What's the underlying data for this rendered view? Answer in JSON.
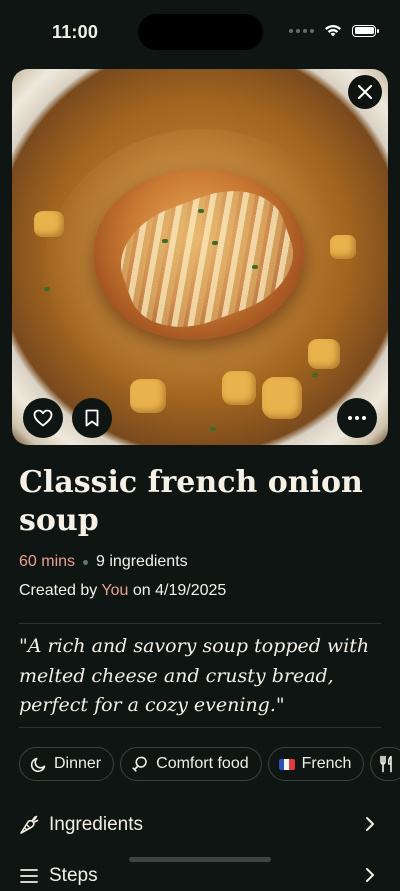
{
  "status_bar": {
    "time": "11:00"
  },
  "hero": {
    "image_alt": "Bowl of french onion soup topped with cheesy toast",
    "close_icon": "close-icon",
    "favorite_icon": "heart-icon",
    "bookmark_icon": "bookmark-icon",
    "more_icon": "more-horizontal-icon"
  },
  "recipe": {
    "title": "Classic french onion soup",
    "duration": "60 mins",
    "ingredient_count": "9 ingredients",
    "created_prefix": "Created by",
    "author": "You",
    "created_suffix": "on 4/19/2025",
    "description": "\"A rich and savory soup topped with melted cheese and crusty bread, perfect for a cozy evening.\""
  },
  "tags": [
    {
      "label": "Dinner",
      "icon": "moon-icon"
    },
    {
      "label": "Comfort food",
      "icon": "drumstick-icon"
    },
    {
      "label": "French",
      "icon": "france-flag-icon"
    },
    {
      "label": "",
      "icon": "utensils-icon"
    }
  ],
  "sections": [
    {
      "label": "Ingredients",
      "icon": "carrot-icon"
    },
    {
      "label": "Steps",
      "icon": "list-icon"
    }
  ],
  "colors": {
    "background": "#0f1512",
    "accent": "#e8a08f",
    "text": "#f3efe6",
    "chip_border": "#3a443f"
  }
}
